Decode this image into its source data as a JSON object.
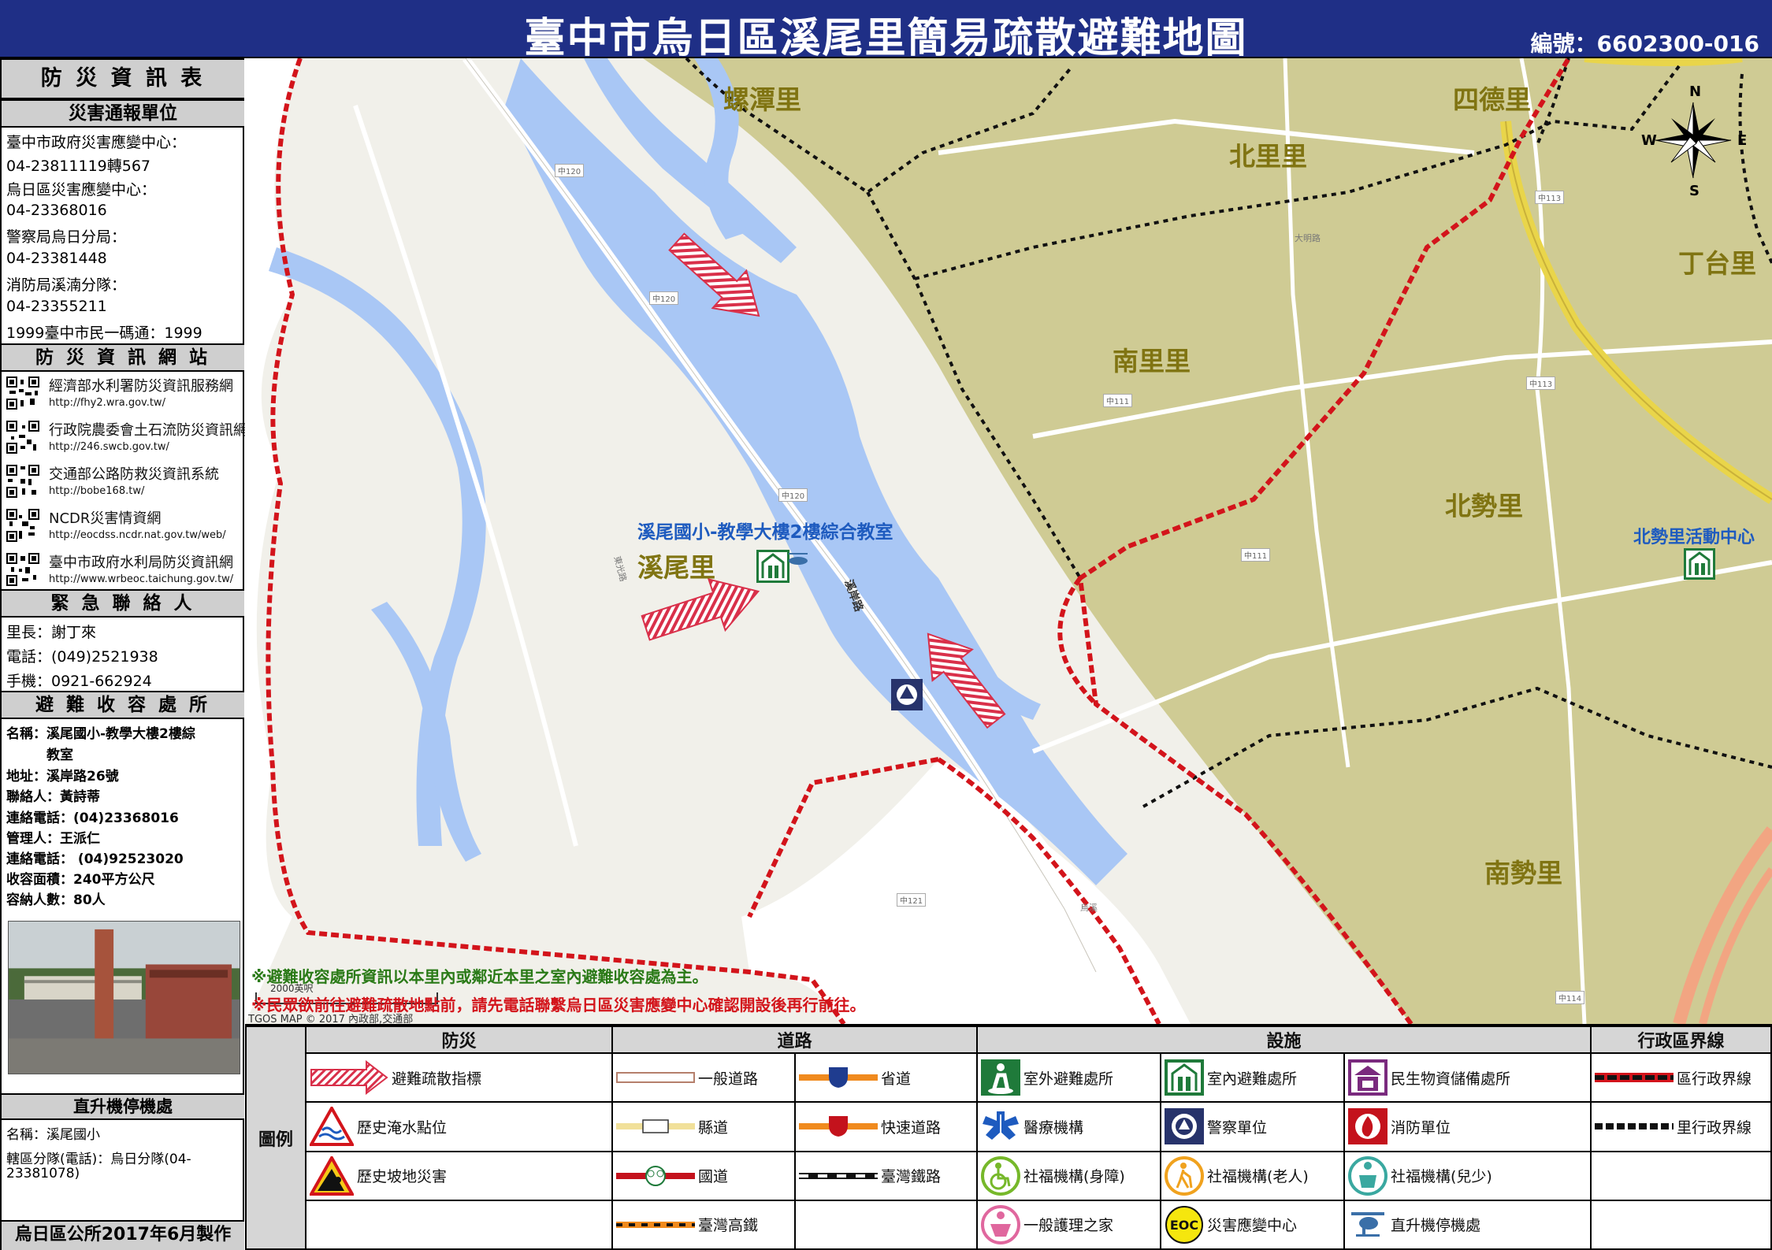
{
  "header": {
    "title": "臺中市烏日區溪尾里簡易疏散避難地圖",
    "serial": "編號：6602300-016"
  },
  "sidebar": {
    "info_title": "防 災 資 訊 表",
    "report_title": "災害通報單位",
    "report_lines": [
      "臺中市政府災害應變中心：",
      "04-23811119轉567",
      "烏日區災害應變中心：",
      "04-23368016",
      "警察局烏日分局：",
      "04-23381448",
      "消防局溪湳分隊：",
      "04-23355211",
      "1999臺中市民一碼通：1999"
    ],
    "sites_title": "防 災 資 訊 網 站",
    "sites": [
      {
        "name": "經濟部水利署防災資訊服務網",
        "url": "http://fhy2.wra.gov.tw/"
      },
      {
        "name": "行政院農委會土石流防災資訊網",
        "url": "http://246.swcb.gov.tw/"
      },
      {
        "name": "交通部公路防救災資訊系統",
        "url": "http://bobe168.tw/"
      },
      {
        "name": "NCDR災害情資網",
        "url": "http://eocdss.ncdr.nat.gov.tw/web/"
      },
      {
        "name": "臺中市政府水利局防災資訊網",
        "url": "http://www.wrbeoc.taichung.gov.tw/"
      }
    ],
    "contact_title": "緊 急 聯 絡 人",
    "contact_lines": [
      "里長：謝丁來",
      "電話：(049)2521938",
      "手機：0921-662924"
    ],
    "shelter_title": "避 難 收 容 處 所",
    "shelter_lines": [
      "名稱：溪尾國小-教學大樓2樓綜",
      "　　　教室",
      "地址：溪岸路26號",
      "聯絡人：黃詩蒂",
      "連絡電話：(04)23368016",
      "管理人：王派仁",
      "連絡電話： (04)92523020",
      "收容面積：240平方公尺",
      "容納人數：80人"
    ],
    "heli_title": "直升機停機處",
    "heli_lines": [
      "名稱：溪尾國小",
      "轄區分隊(電話)：烏日分隊(04-",
      "23381078)"
    ],
    "footer": "烏日區公所2017年6月製作"
  },
  "map": {
    "villages": [
      "螺潭里",
      "北里里",
      "四德里",
      "丁台里",
      "南里里",
      "北勢里",
      "南勢里",
      "溪尾里"
    ],
    "shelter_label": "溪尾國小-教學大樓2樓綜合教室",
    "activity_center": "北勢里活動中心",
    "road_tags": [
      "中120",
      "中120",
      "中120",
      "中121",
      "中113",
      "中111",
      "中111",
      "中114",
      "中113"
    ],
    "street_names": [
      "溪岸路",
      "大明路",
      "東光路",
      "烏溪"
    ],
    "compass": {
      "n": "N",
      "s": "S",
      "e": "E",
      "w": "W"
    },
    "scale_text": "2000英呎",
    "tgos": "TGOS MAP © 2017 內政部,交通部",
    "note1": "※避難收容處所資訊以本里內或鄰近本里之室內避難收容處為主。",
    "note2": "※民眾欲前往避難疏散地點前，請先電話聯繫烏日區災害應變中心確認開設後再行前往。"
  },
  "legend": {
    "side_label": "圖例",
    "headers": [
      "防災",
      "道路",
      "設施",
      "行政區界線"
    ],
    "disaster": [
      "避難疏散指標",
      "歷史淹水點位",
      "歷史坡地災害"
    ],
    "roads": [
      "一般道路",
      "省道",
      "縣道",
      "快速道路",
      "國道",
      "臺灣鐵路",
      "臺灣高鐵"
    ],
    "facilities": [
      "室外避難處所",
      "室內避難處所",
      "民生物資儲備處所",
      "醫療機構",
      "警察單位",
      "消防單位",
      "社福機構(身障)",
      "社福機構(老人)",
      "社福機構(兒少)",
      "一般護理之家",
      "災害應變中心",
      "直升機停機處"
    ],
    "boundaries": [
      "區行政界線",
      "里行政界線"
    ],
    "eoc_text": "EOC"
  },
  "colors": {
    "header_bg": "#1f2f86",
    "village_fill": "#cfcb94",
    "river": "#a9c7f5",
    "district_border": "#d3141b",
    "village_text": "#807412",
    "arrow": "#d9304a"
  }
}
